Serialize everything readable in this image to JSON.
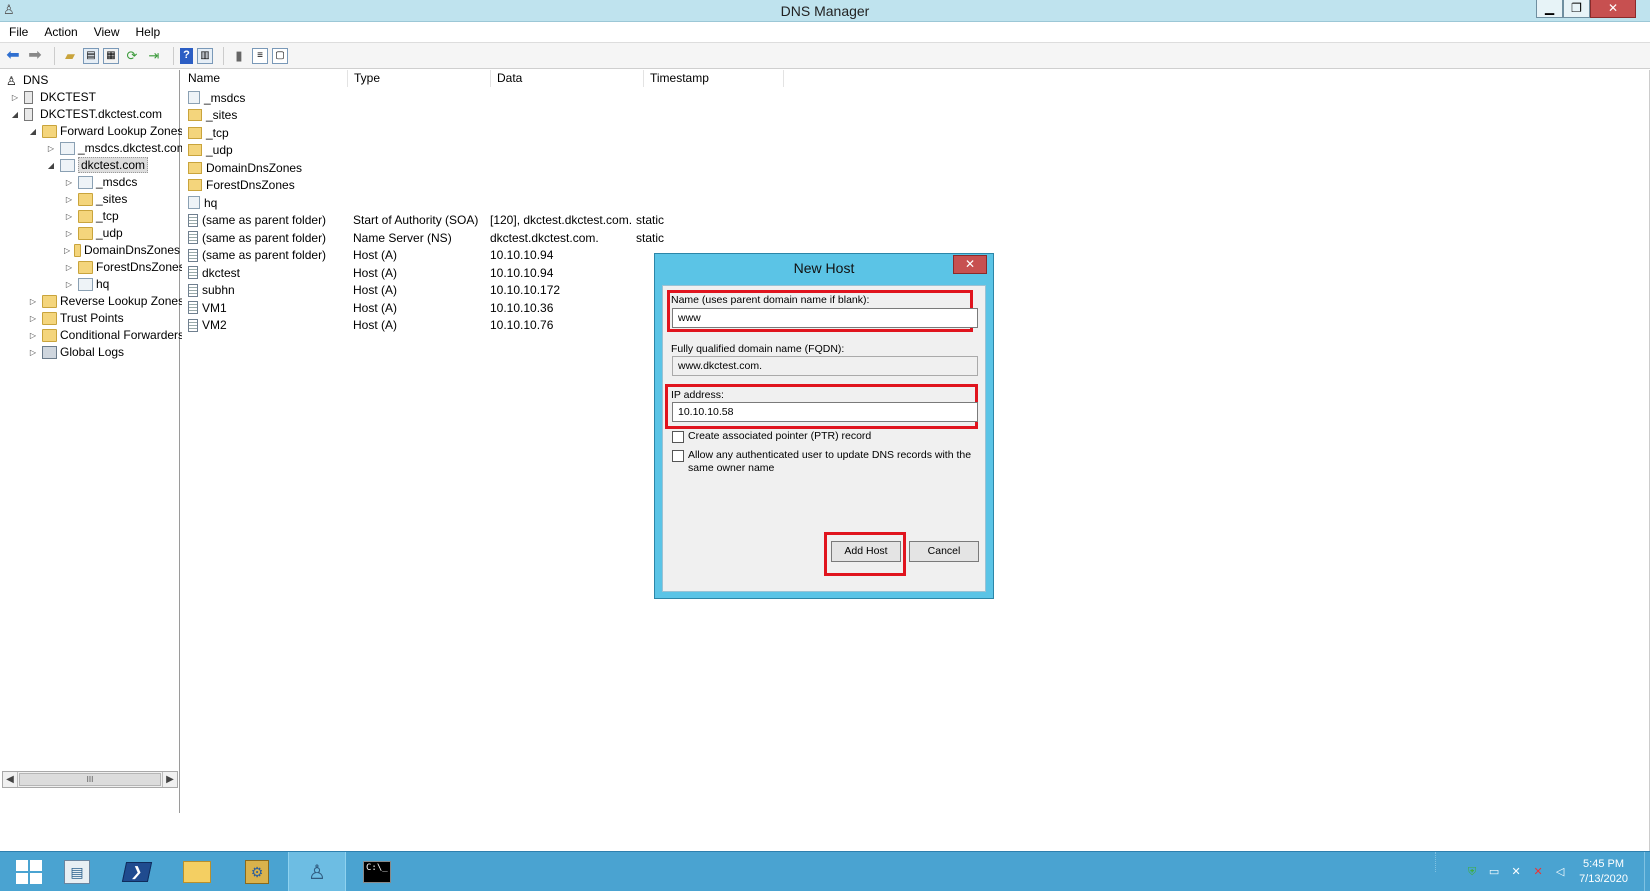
{
  "window": {
    "title": "DNS Manager",
    "minimize": "▁",
    "maximize": "❐",
    "close": "✕"
  },
  "menu": [
    "File",
    "Action",
    "View",
    "Help"
  ],
  "tree": {
    "root": "DNS",
    "items": [
      {
        "label": "DKCTEST",
        "exp": "▷"
      },
      {
        "label": "DKCTEST.dkctest.com",
        "exp": "◢"
      },
      {
        "label": "Forward Lookup Zones",
        "exp": "◢"
      },
      {
        "label": "_msdcs.dkctest.com",
        "exp": "▷"
      },
      {
        "label": "dkctest.com",
        "exp": "◢"
      },
      {
        "label": "_msdcs",
        "exp": "▷"
      },
      {
        "label": "_sites",
        "exp": "▷"
      },
      {
        "label": "_tcp",
        "exp": "▷"
      },
      {
        "label": "_udp",
        "exp": "▷"
      },
      {
        "label": "DomainDnsZones",
        "exp": "▷"
      },
      {
        "label": "ForestDnsZones",
        "exp": "▷"
      },
      {
        "label": "hq",
        "exp": "▷"
      },
      {
        "label": "Reverse Lookup Zones",
        "exp": "▷"
      },
      {
        "label": "Trust Points",
        "exp": "▷"
      },
      {
        "label": "Conditional Forwarders",
        "exp": "▷"
      },
      {
        "label": "Global Logs",
        "exp": "▷"
      }
    ],
    "scroll_thumb": "III"
  },
  "list": {
    "columns": [
      "Name",
      "Type",
      "Data",
      "Timestamp"
    ],
    "rows": [
      {
        "name": "_msdcs",
        "type": "",
        "data": "",
        "timestamp": "",
        "icon": "zone"
      },
      {
        "name": "_sites",
        "type": "",
        "data": "",
        "timestamp": "",
        "icon": "folder"
      },
      {
        "name": "_tcp",
        "type": "",
        "data": "",
        "timestamp": "",
        "icon": "folder"
      },
      {
        "name": "_udp",
        "type": "",
        "data": "",
        "timestamp": "",
        "icon": "folder"
      },
      {
        "name": "DomainDnsZones",
        "type": "",
        "data": "",
        "timestamp": "",
        "icon": "folder"
      },
      {
        "name": "ForestDnsZones",
        "type": "",
        "data": "",
        "timestamp": "",
        "icon": "folder"
      },
      {
        "name": "hq",
        "type": "",
        "data": "",
        "timestamp": "",
        "icon": "zone"
      },
      {
        "name": "(same as parent folder)",
        "type": "Start of Authority (SOA)",
        "data": "[120], dkctest.dkctest.com...",
        "timestamp": "static",
        "icon": "rec"
      },
      {
        "name": "(same as parent folder)",
        "type": "Name Server (NS)",
        "data": "dkctest.dkctest.com.",
        "timestamp": "static",
        "icon": "rec"
      },
      {
        "name": "(same as parent folder)",
        "type": "Host (A)",
        "data": "10.10.10.94",
        "timestamp": "",
        "icon": "rec"
      },
      {
        "name": "dkctest",
        "type": "Host (A)",
        "data": "10.10.10.94",
        "timestamp": "",
        "icon": "rec"
      },
      {
        "name": "subhn",
        "type": "Host (A)",
        "data": "10.10.10.172",
        "timestamp": "",
        "icon": "rec"
      },
      {
        "name": "VM1",
        "type": "Host (A)",
        "data": "10.10.10.36",
        "timestamp": "",
        "icon": "rec"
      },
      {
        "name": "VM2",
        "type": "Host (A)",
        "data": "10.10.10.76",
        "timestamp": "",
        "icon": "rec"
      }
    ]
  },
  "dialog": {
    "title": "New Host",
    "close": "✕",
    "name_label": "Name (uses parent domain name if blank):",
    "name_value": "www",
    "fqdn_label": "Fully qualified domain name (FQDN):",
    "fqdn_value": "www.dkctest.com.",
    "ip_label": "IP address:",
    "ip_value": "10.10.10.58",
    "ptr_label": "Create associated pointer (PTR) record",
    "allow_label": "Allow any authenticated user to update DNS records with the same owner name",
    "ptr_checked": false,
    "allow_checked": false,
    "add_button": "Add Host",
    "cancel_button": "Cancel",
    "highlight_color": "#e0141e"
  },
  "taskbar": {
    "apps": [
      "start-icon",
      "server-manager-icon",
      "powershell-icon",
      "file-explorer-icon",
      "admin-tools-icon",
      "dns-manager-icon",
      "cmd-icon"
    ],
    "ps_glyph": "❯",
    "cmd_glyph": "C:\\_",
    "clock_time": "5:45 PM",
    "clock_date": "7/13/2020"
  }
}
